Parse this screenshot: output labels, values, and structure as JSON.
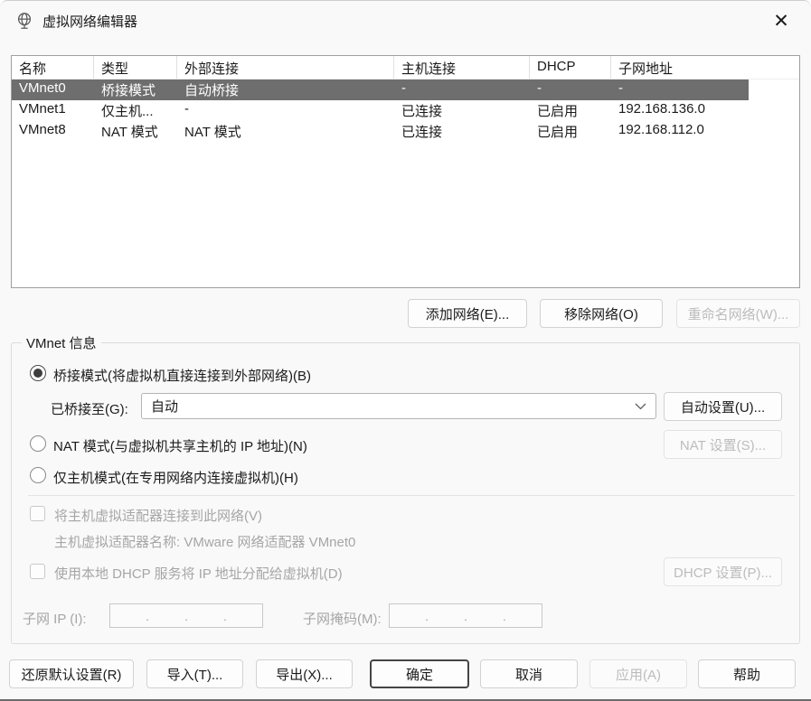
{
  "window": {
    "title": "虚拟网络编辑器",
    "close_glyph": "✕",
    "app_icon": "globe-network"
  },
  "colors": {
    "selected_row_bg": "#6e6e6e",
    "selected_row_text": "#ffffff",
    "disabled_text": "#a6a6a6",
    "dialog_bg": "#f9f9f9"
  },
  "table": {
    "columns": [
      "名称",
      "类型",
      "外部连接",
      "主机连接",
      "DHCP",
      "子网地址"
    ],
    "rows": [
      {
        "name": "VMnet0",
        "type": "桥接模式",
        "external": "自动桥接",
        "host": "-",
        "dhcp": "-",
        "subnet": "-",
        "selected": true
      },
      {
        "name": "VMnet1",
        "type": "仅主机...",
        "external": "-",
        "host": "已连接",
        "dhcp": "已启用",
        "subnet": "192.168.136.0",
        "selected": false
      },
      {
        "name": "VMnet8",
        "type": "NAT 模式",
        "external": "NAT 模式",
        "host": "已连接",
        "dhcp": "已启用",
        "subnet": "192.168.112.0",
        "selected": false
      }
    ]
  },
  "actions": {
    "add": "添加网络(E)...",
    "remove": "移除网络(O)",
    "rename": "重命名网络(W)..."
  },
  "vmnet_info": {
    "group_label": "VMnet 信息",
    "bridged_radio": "桥接模式(将虚拟机直接连接到外部网络)(B)",
    "bridged_to_label": "已桥接至(G):",
    "bridged_to_value": "自动",
    "auto_settings": "自动设置(U)...",
    "nat_radio": "NAT 模式(与虚拟机共享主机的 IP 地址)(N)",
    "nat_settings": "NAT 设置(S)...",
    "hostonly_radio": "仅主机模式(在专用网络内连接虚拟机)(H)",
    "connect_host_checkbox": "将主机虚拟适配器连接到此网络(V)",
    "adapter_name": "主机虚拟适配器名称: VMware 网络适配器 VMnet0",
    "dhcp_checkbox": "使用本地 DHCP 服务将 IP 地址分配给虚拟机(D)",
    "dhcp_settings": "DHCP 设置(P)...",
    "subnet_ip_label": "子网 IP (I):",
    "subnet_mask_label": "子网掩码(M):",
    "ip_dot": "."
  },
  "footer": {
    "restore": "还原默认设置(R)",
    "import": "导入(T)...",
    "export": "导出(X)...",
    "ok": "确定",
    "cancel": "取消",
    "apply": "应用(A)",
    "help": "帮助"
  }
}
